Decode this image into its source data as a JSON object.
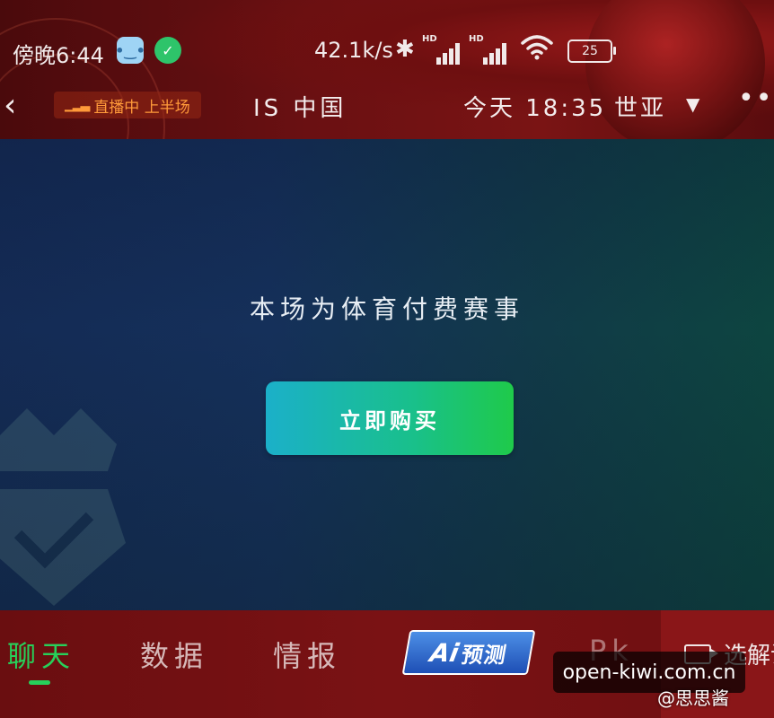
{
  "status_bar": {
    "time": "傍晚6:44",
    "network_speed": "42.1k/s",
    "signal_label_1": "HD",
    "signal_label_2": "HD",
    "battery": "25",
    "app_badge_1": "•‿•",
    "app_badge_2": "✓"
  },
  "match_bar": {
    "back_icon": "chevron-left-icon",
    "live_status": "直播中 上半场",
    "team_left": "IS 中国",
    "match_time": "今天 18:35",
    "team_right": "世亚",
    "more_icon": "more-dots-icon"
  },
  "player": {
    "paid_notice": "本场为体育付费赛事",
    "buy_button_label": "立即购买"
  },
  "tabs": [
    {
      "label": "聊天",
      "active": true
    },
    {
      "label": "数据",
      "active": false
    },
    {
      "label": "情报",
      "active": false
    },
    {
      "label_mark": "Ai",
      "label_text": "预测",
      "active": false
    },
    {
      "label": "Pk",
      "active": false
    }
  ],
  "select_commentary_label": "选解说",
  "watermarks": {
    "site": "open-kiwi.com.cn",
    "author": "@思思酱"
  },
  "colors": {
    "active_tab": "#27d05a",
    "buy_button_start": "#1bb0c9",
    "buy_button_end": "#1fca4a",
    "header_red": "#7a1414",
    "live_text": "#ff9a3a"
  }
}
